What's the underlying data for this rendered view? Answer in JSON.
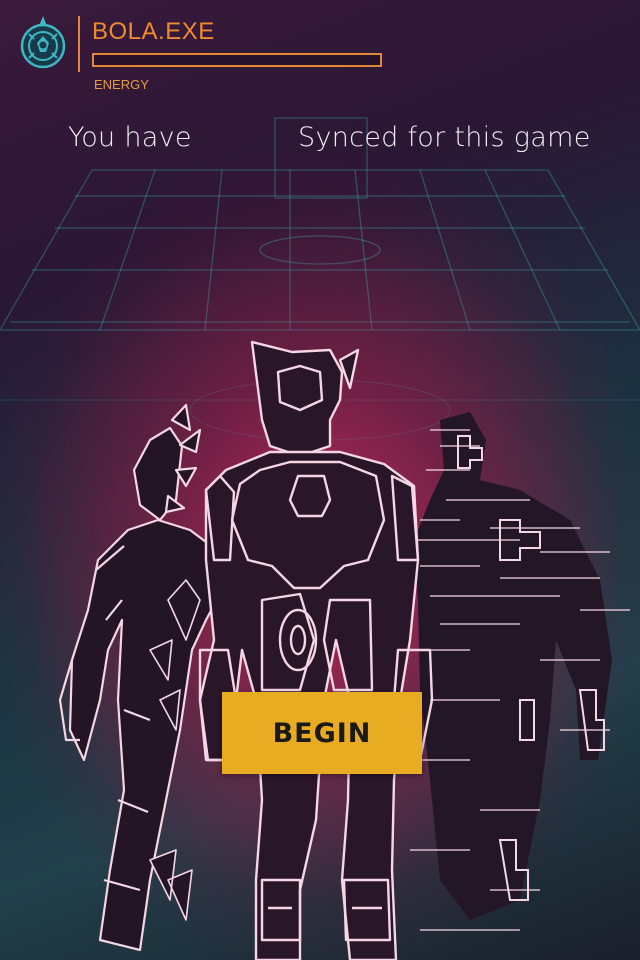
{
  "header": {
    "app_title": "BOLA.EXE",
    "energy_label": "ENERGY",
    "energy_level": 0
  },
  "message": {
    "left": "You have",
    "right": "Synced for this game"
  },
  "actions": {
    "begin_label": "BEGIN"
  },
  "colors": {
    "accent_orange": "#e2873a",
    "button_yellow": "#e8ac22",
    "grid_teal": "#3fb6c4",
    "figure_outline": "#f4d6e4",
    "glow_magenta": "#be2355"
  },
  "icons": {
    "logo": "emblem-icon"
  }
}
